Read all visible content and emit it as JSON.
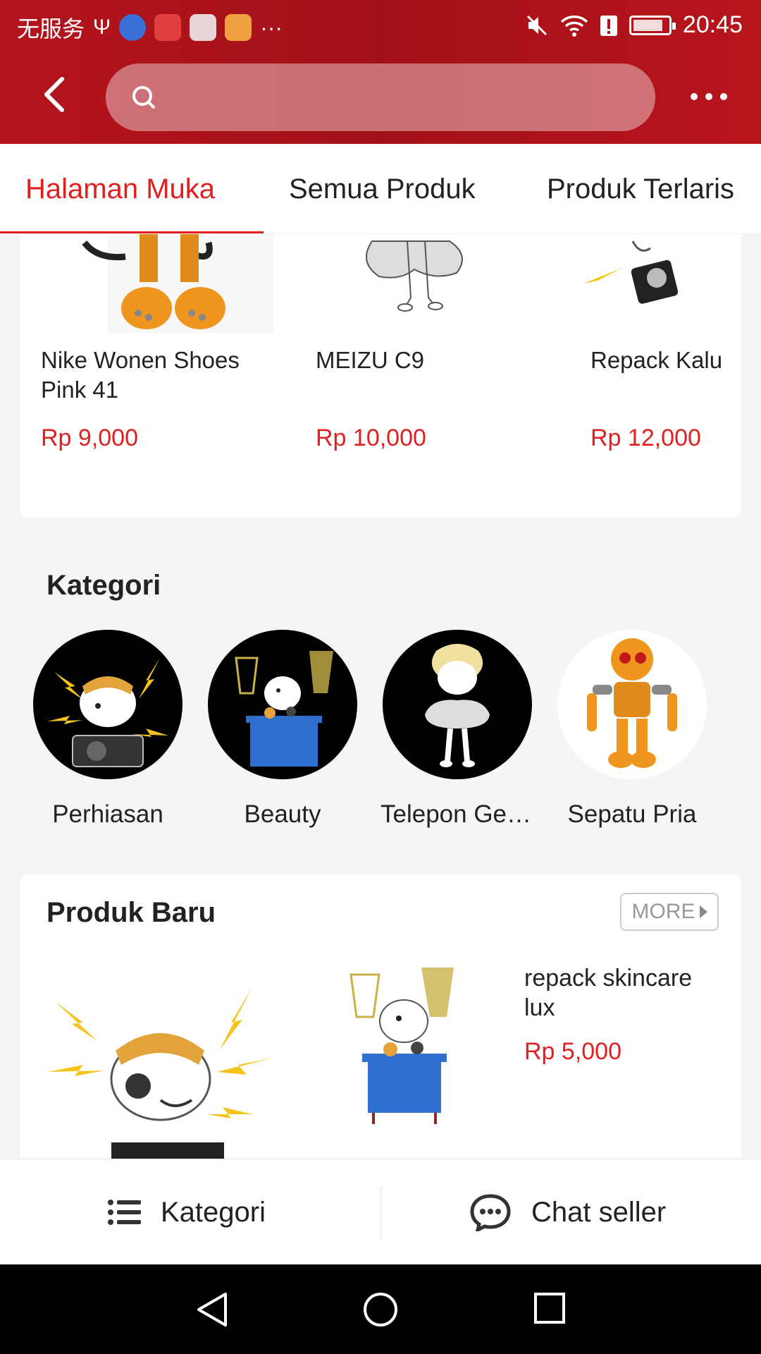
{
  "status_bar": {
    "carrier": "无服务",
    "more_dots": "···",
    "time": "20:45",
    "battery_level": 0.85
  },
  "header": {
    "search_placeholder": ""
  },
  "tabs": [
    {
      "label": "Halaman Muka",
      "active": true
    },
    {
      "label": "Semua Produk",
      "active": false
    },
    {
      "label": "Produk Terlaris",
      "active": false
    }
  ],
  "featured_products": [
    {
      "name": "Nike Wonen Shoes Pink 41",
      "price": "Rp 9,000"
    },
    {
      "name": "MEIZU C9",
      "price": "Rp 10,000"
    },
    {
      "name": "Repack Kalu",
      "price": "Rp 12,000"
    }
  ],
  "categories": {
    "title": "Kategori",
    "items": [
      {
        "label": "Perhiasan"
      },
      {
        "label": "Beauty"
      },
      {
        "label": "Telepon Gen..."
      },
      {
        "label": "Sepatu Pria"
      }
    ]
  },
  "new_products": {
    "title": "Produk Baru",
    "more_label": "MORE",
    "item": {
      "name": "repack skincare lux",
      "price": "Rp 5,000"
    }
  },
  "action_bar": {
    "category_label": "Kategori",
    "chat_label": "Chat seller"
  },
  "colors": {
    "brand_red": "#b4141d",
    "accent_red": "#e02020",
    "price_red": "#e02020"
  }
}
